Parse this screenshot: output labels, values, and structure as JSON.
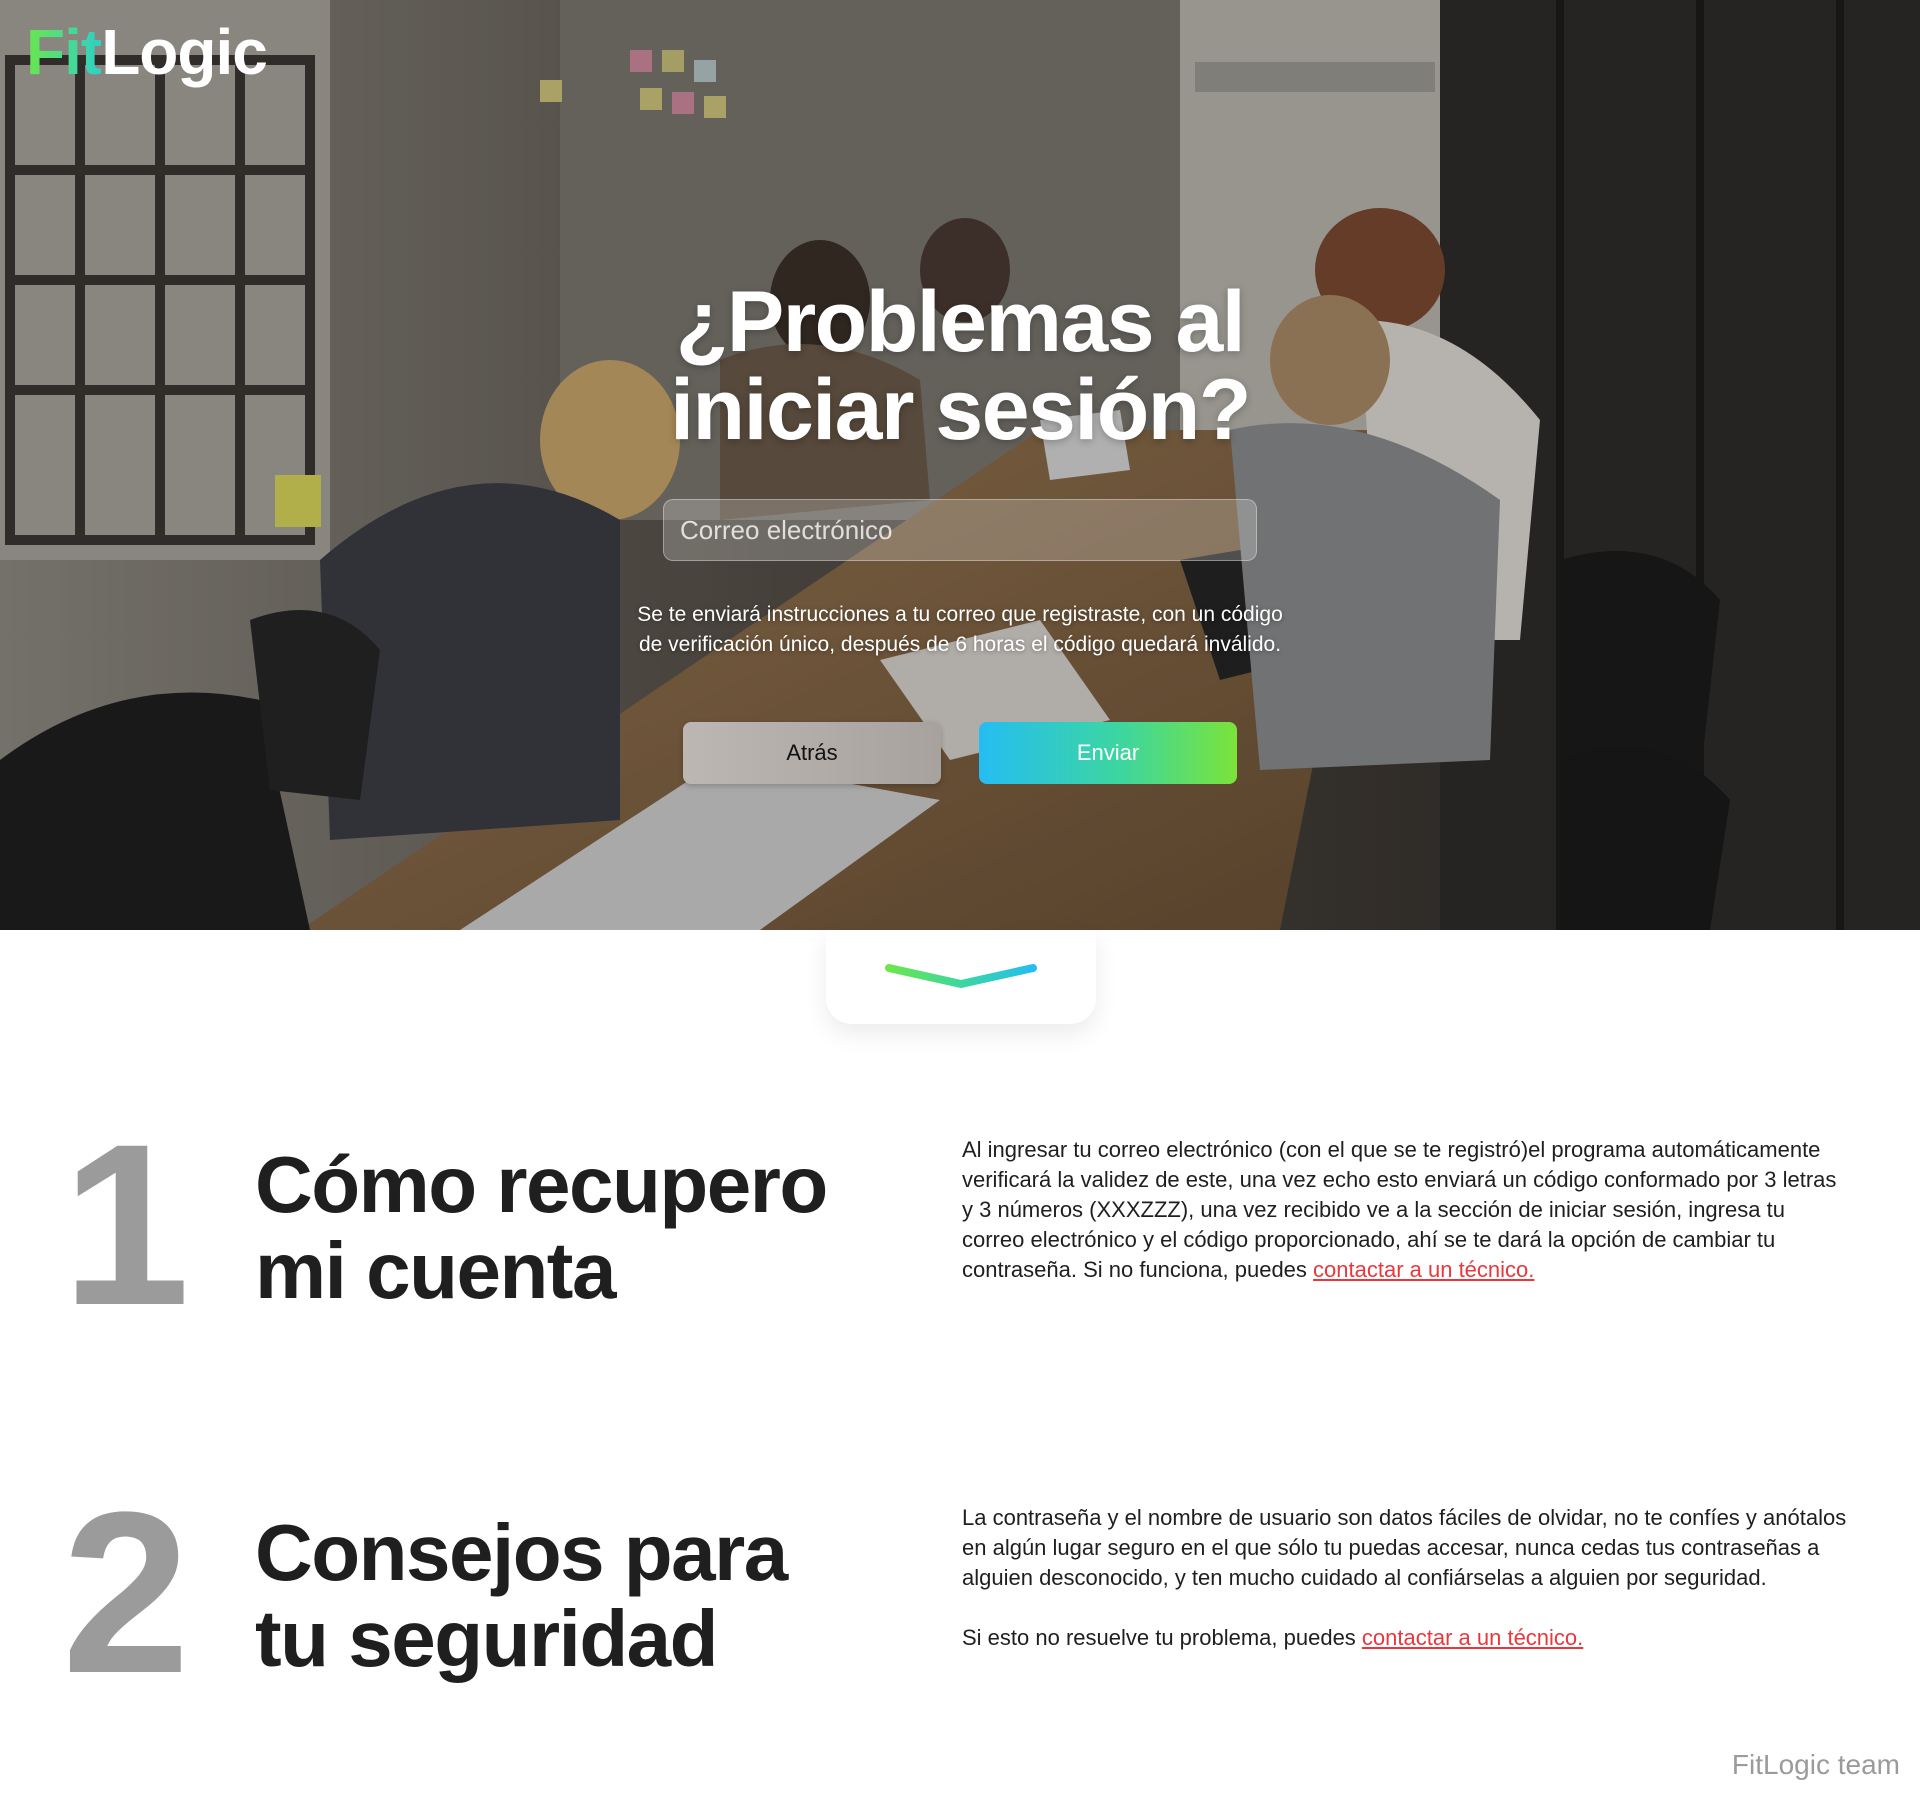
{
  "brand": {
    "logo_part1": "Fit",
    "logo_part2": "Logic"
  },
  "hero": {
    "title_line1": "¿Problemas al",
    "title_line2": "iniciar sesión?",
    "email_placeholder": "Correo electrónico",
    "note": "Se te enviará instrucciones a tu correo que registraste, con un código de verificación único, después de 6 horas el código quedará inválido.",
    "back_label": "Atrás",
    "send_label": "Enviar",
    "background_icon": "office-meeting-photo"
  },
  "scroll": {
    "icon": "chevron-down-icon"
  },
  "sections": [
    {
      "number": "1",
      "heading_line1": "Cómo recupero",
      "heading_line2": "mi cuenta",
      "body_text": "Al ingresar tu correo electrónico (con el que se te registró)el programa automáticamente verificará la validez de este, una vez echo esto enviará un código conformado por 3 letras y 3 números (XXXZZZ), una vez recibido ve a la sección de iniciar sesión, ingresa tu correo electrónico y el código proporcionado, ahí se te dará la opción de cambiar tu contraseña. Si no funciona, puedes ",
      "link_label": "contactar a un técnico."
    },
    {
      "number": "2",
      "heading_line1": "Consejos para",
      "heading_line2": "tu seguridad",
      "body_text": "La contraseña y el nombre de usuario son datos fáciles de olvidar, no te confíes y anótalos en algún lugar seguro en el que sólo tu puedas accesar, nunca cedas tus contraseñas a alguien desconocido, y ten mucho cuidado al confiárselas a alguien por seguridad.",
      "body_text2": "Si esto no resuelve tu problema, puedes ",
      "link_label": "contactar a un técnico."
    }
  ],
  "footer": {
    "signature": "FitLogic team"
  },
  "colors": {
    "accent_green": "#7be33a",
    "accent_blue": "#25bdf2",
    "link_red": "#e8383d",
    "number_gray": "#9b9b9b"
  }
}
